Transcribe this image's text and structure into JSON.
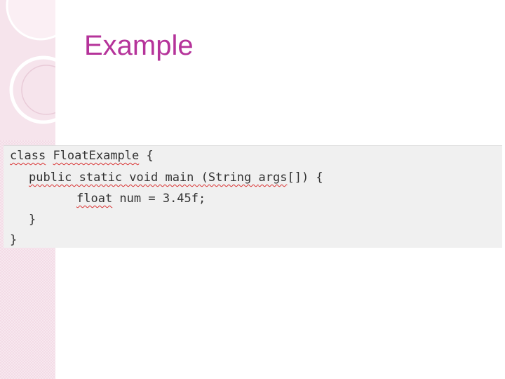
{
  "slide": {
    "title": "Example"
  },
  "code": {
    "line1": {
      "kw": "class",
      "sp": " ",
      "name": "FloatExample",
      "rest": " {"
    },
    "line2": {
      "pre": "public static void main (String ",
      "args": "args",
      "rest": "[]) {"
    },
    "line3": {
      "kw": "float",
      "rest": " num = 3.45f;"
    },
    "line4": {
      "text": "}"
    },
    "line5": {
      "text": "}"
    }
  },
  "colors": {
    "title": "#b5339a",
    "accent_strip": "#f3dbe6",
    "code_background": "#f0f0f0",
    "squiggle": "#d93030"
  }
}
